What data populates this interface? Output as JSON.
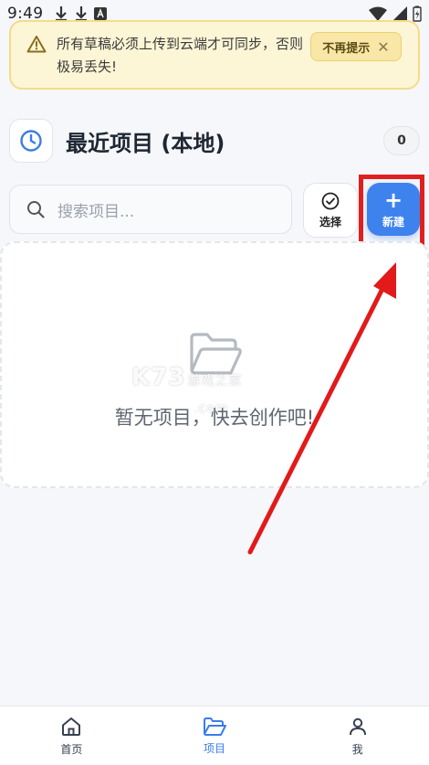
{
  "status_bar": {
    "time": "9:49"
  },
  "notice": {
    "text": "所有草稿必须上传到云端才可同步，否则极易丢失!",
    "dismiss_label": "不再提示",
    "close_glyph": "✕"
  },
  "section": {
    "title": "最近项目 (本地)",
    "count": "0"
  },
  "search": {
    "placeholder": "搜索项目..."
  },
  "actions": {
    "select_label": "选择",
    "new_label": "新建",
    "new_glyph": "+"
  },
  "empty_state": {
    "text": "暂无项目，快去创作吧!"
  },
  "watermark": {
    "main": "K73",
    "sub": "游戏之家",
    "domain": ".com"
  },
  "nav": {
    "items": [
      {
        "label": "首页",
        "icon": "home-icon",
        "active": false
      },
      {
        "label": "项目",
        "icon": "folder-icon",
        "active": true
      },
      {
        "label": "我",
        "icon": "user-icon",
        "active": false
      }
    ]
  },
  "colors": {
    "accent": "#3e82ee",
    "highlight": "#e02020",
    "warning_bg": "#fdf6d6"
  }
}
